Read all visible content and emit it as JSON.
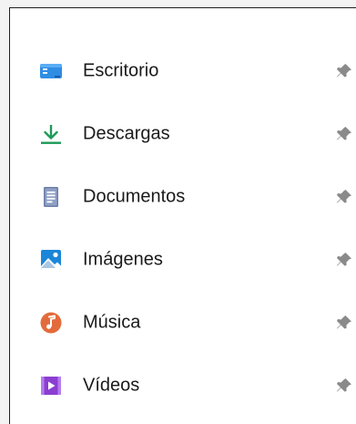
{
  "quick_access": {
    "items": [
      {
        "label": "Escritorio",
        "icon": "desktop-icon",
        "pinned": true
      },
      {
        "label": "Descargas",
        "icon": "downloads-icon",
        "pinned": true
      },
      {
        "label": "Documentos",
        "icon": "documents-icon",
        "pinned": true
      },
      {
        "label": "Imágenes",
        "icon": "pictures-icon",
        "pinned": true
      },
      {
        "label": "Música",
        "icon": "music-icon",
        "pinned": true
      },
      {
        "label": "Vídeos",
        "icon": "videos-icon",
        "pinned": true
      }
    ]
  },
  "colors": {
    "desktop": "#2f8de4",
    "downloads": "#1e9a57",
    "documents": "#6d7fa8",
    "pictures": "#1b86d8",
    "music": "#e36b3b",
    "videos": "#8a3fd1",
    "pin": "#8a8a8a",
    "text": "#1a1a1a"
  }
}
